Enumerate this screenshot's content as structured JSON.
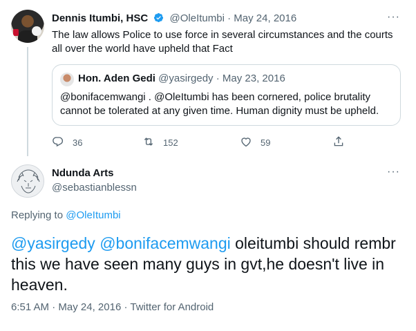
{
  "parent_tweet": {
    "author_name": "Dennis Itumbi, HSC",
    "handle": "@OleItumbi",
    "separator": "·",
    "date": "May 24, 2016",
    "more": "···",
    "text": "The law allows Police to use force in several circumstances and the courts all over the world have upheld that Fact",
    "quote": {
      "author_name": "Hon. Aden Gedi",
      "handle": "@yasirgedy",
      "separator": "·",
      "date": "May 23, 2016",
      "text": "@bonifacemwangi . @OleItumbi has been cornered, police brutality cannot be tolerated at any given time. Human dignity must be upheld."
    },
    "actions": {
      "replies": "36",
      "retweets": "152",
      "likes": "59"
    }
  },
  "main_tweet": {
    "author_name": "Ndunda Arts",
    "handle": "@sebastianblessn",
    "more": "···",
    "replying_prefix": "Replying to",
    "replying_to": "@OleItumbi",
    "mention1": "@yasirgedy",
    "mention2": "@bonifacemwangi",
    "text_rest": " oleitumbi should rembr this we have seen many guys in gvt,he doesn't live in heaven.",
    "time": "6:51 AM",
    "separator": "·",
    "date": "May 24, 2016",
    "source": "Twitter for Android"
  },
  "colors": {
    "accent": "#1d9bf0",
    "text": "#0f1419",
    "muted": "#536471",
    "border": "#cfd9de"
  }
}
